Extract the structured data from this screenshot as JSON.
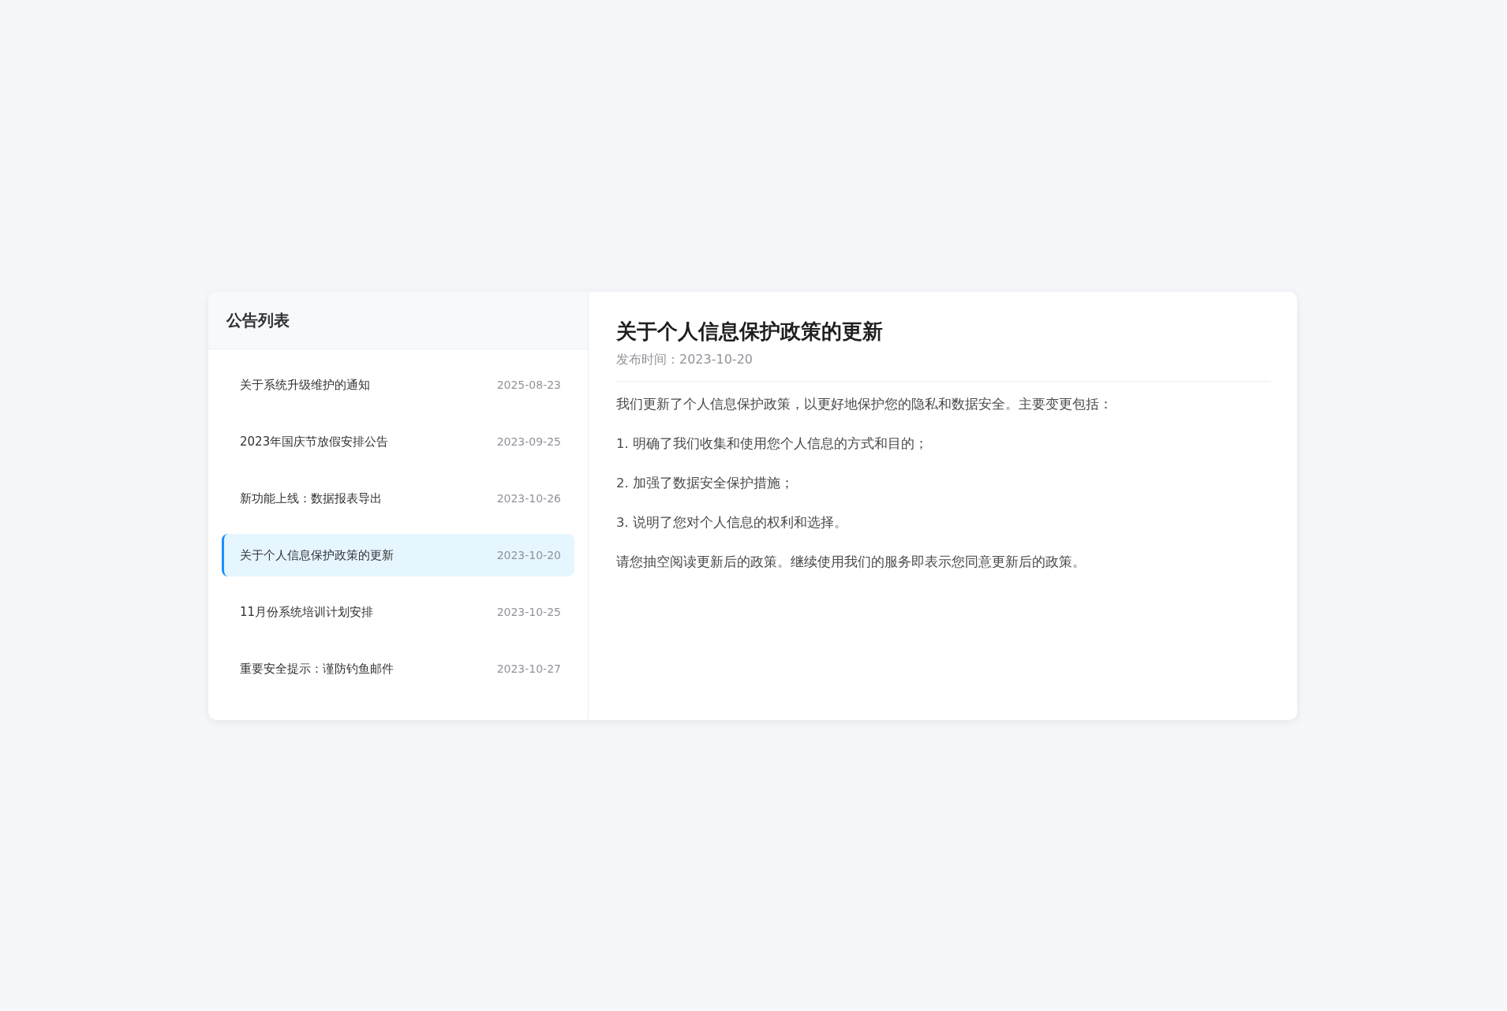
{
  "sidebar": {
    "title": "公告列表",
    "items": [
      {
        "title": "关于系统升级维护的通知",
        "date": "2025-08-23",
        "selected": false
      },
      {
        "title": "2023年国庆节放假安排公告",
        "date": "2023-09-25",
        "selected": false
      },
      {
        "title": "新功能上线：数据报表导出",
        "date": "2023-10-26",
        "selected": false
      },
      {
        "title": "关于个人信息保护政策的更新",
        "date": "2023-10-20",
        "selected": true
      },
      {
        "title": "11月份系统培训计划安排",
        "date": "2023-10-25",
        "selected": false
      },
      {
        "title": "重要安全提示：谨防钓鱼邮件",
        "date": "2023-10-27",
        "selected": false
      }
    ]
  },
  "detail": {
    "title": "关于个人信息保护政策的更新",
    "meta": "发布时间：2023-10-20",
    "paragraphs": [
      "我们更新了个人信息保护政策，以更好地保护您的隐私和数据安全。主要变更包括：",
      "1. 明确了我们收集和使用您个人信息的方式和目的；",
      "2. 加强了数据安全保护措施；",
      "3. 说明了您对个人信息的权利和选择。",
      "请您抽空阅读更新后的政策。继续使用我们的服务即表示您同意更新后的政策。"
    ]
  }
}
